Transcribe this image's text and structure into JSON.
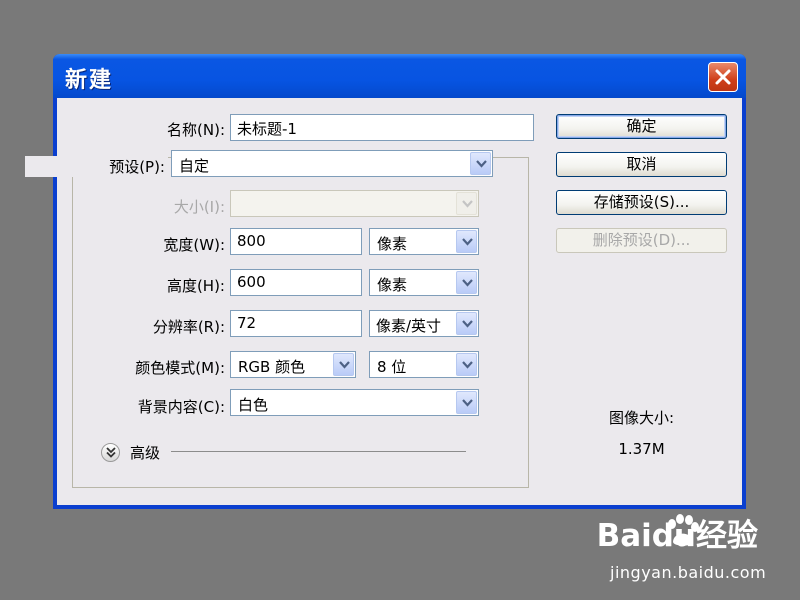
{
  "dialog": {
    "title": "新建"
  },
  "form": {
    "name": {
      "label": "名称(N):",
      "value": "未标题-1"
    },
    "preset": {
      "label": "预设(P):",
      "value": "自定"
    },
    "size": {
      "label": "大小(I):",
      "value": ""
    },
    "width": {
      "label": "宽度(W):",
      "value": "800",
      "unit": "像素"
    },
    "height": {
      "label": "高度(H):",
      "value": "600",
      "unit": "像素"
    },
    "resolution": {
      "label": "分辨率(R):",
      "value": "72",
      "unit": "像素/英寸"
    },
    "color_mode": {
      "label": "颜色模式(M):",
      "value": "RGB 颜色",
      "depth": "8 位"
    },
    "background": {
      "label": "背景内容(C):",
      "value": "白色"
    },
    "advanced": {
      "label": "高级"
    }
  },
  "buttons": {
    "ok": "确定",
    "cancel": "取消",
    "save_preset": "存储预设(S)...",
    "delete_preset": "删除预设(D)..."
  },
  "image_size": {
    "label": "图像大小:",
    "value": "1.37M"
  },
  "watermark": {
    "logo": "Baidu经验",
    "url": "jingyan.baidu.com"
  },
  "colors": {
    "titlebar": "#0754e2",
    "dialog_bg": "#ebe9ed",
    "close_button": "#cf3f1a",
    "desktop": "#797979"
  },
  "icons": [
    "close-icon",
    "chevron-down-icon",
    "expand-double-chevron-icon",
    "baidu-paw-icon"
  ]
}
